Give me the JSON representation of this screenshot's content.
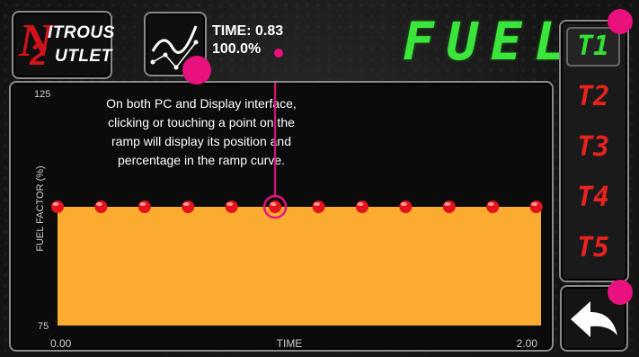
{
  "logo": {
    "line1": "ITROUS",
    "line2": "UTLET",
    "letter_n": "N",
    "digit": "2"
  },
  "readout": {
    "time_label": "TIME: 0.83",
    "percent": "100.0%"
  },
  "title": "FUEL",
  "chart_data": {
    "type": "area",
    "xlabel": "TIME",
    "ylabel": "FUEL FACTOR (%)",
    "xlim": [
      0.0,
      2.0
    ],
    "ylim": [
      75,
      125
    ],
    "x_tick_labels": [
      "0.00",
      "2.00"
    ],
    "y_tick_labels": [
      "125",
      "75"
    ],
    "x": [
      0.0,
      0.18,
      0.36,
      0.54,
      0.72,
      0.9,
      1.08,
      1.26,
      1.44,
      1.62,
      1.8,
      1.98
    ],
    "y": [
      100,
      100,
      100,
      100,
      100,
      100,
      100,
      100,
      100,
      100,
      100,
      100
    ],
    "selected_index": 5,
    "fill_color": "#fbab30",
    "point_color": "#e3131b",
    "annotation": "On both PC and Display interface, clicking or touching a point on the ramp will display its position and percentage in the ramp curve."
  },
  "tabs": [
    {
      "label": "T1",
      "active": true
    },
    {
      "label": "T2",
      "active": false
    },
    {
      "label": "T3",
      "active": false
    },
    {
      "label": "T4",
      "active": false
    },
    {
      "label": "T5",
      "active": false
    }
  ],
  "colors": {
    "highlight": "#e8117e",
    "active_tab": "#33e033",
    "inactive_tab": "#e8231f"
  },
  "icons": {
    "graph": "ramp-graph-icon",
    "back": "back-arrow-icon"
  }
}
